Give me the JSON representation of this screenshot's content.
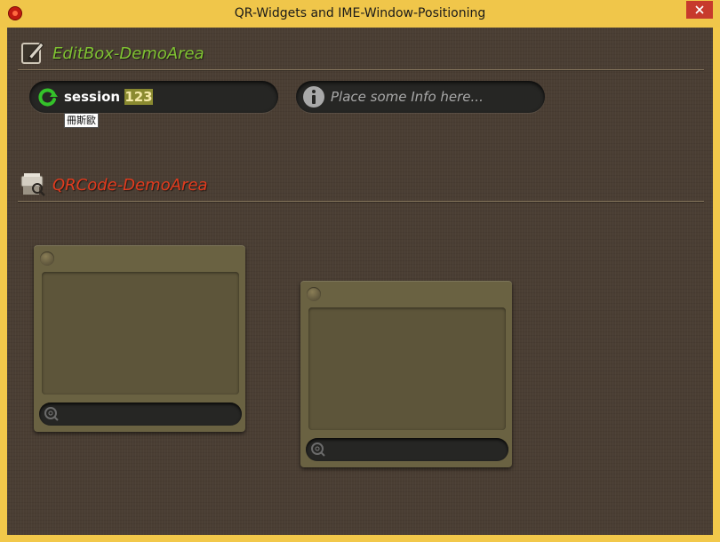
{
  "window": {
    "title": "QR-Widgets and IME-Window-Positioning",
    "colors": {
      "titlebar": "#f0c64a",
      "close_button": "#c73a2c",
      "background": "#4a3e33"
    }
  },
  "editbox_section": {
    "title": "EditBox-DemoArea",
    "icon": "edit-note-icon",
    "title_color": "#7fc232"
  },
  "editbox_session": {
    "icon": "refresh-arrow-icon",
    "typed_text": "session ",
    "composing_text": "123"
  },
  "ime_candidate": {
    "text": "冊斯歐"
  },
  "editbox_info": {
    "icon": "info-icon",
    "placeholder": "Place some Info here..."
  },
  "qrcode_section": {
    "title": "QRCode-DemoArea",
    "icon": "qr-scanner-icon",
    "title_color": "#e23b1e"
  },
  "qr_panels": [
    {
      "knob_icon": "knob-icon",
      "input_icon": "zoom-icon",
      "input_value": ""
    },
    {
      "knob_icon": "knob-icon",
      "input_icon": "zoom-icon",
      "input_value": ""
    }
  ]
}
